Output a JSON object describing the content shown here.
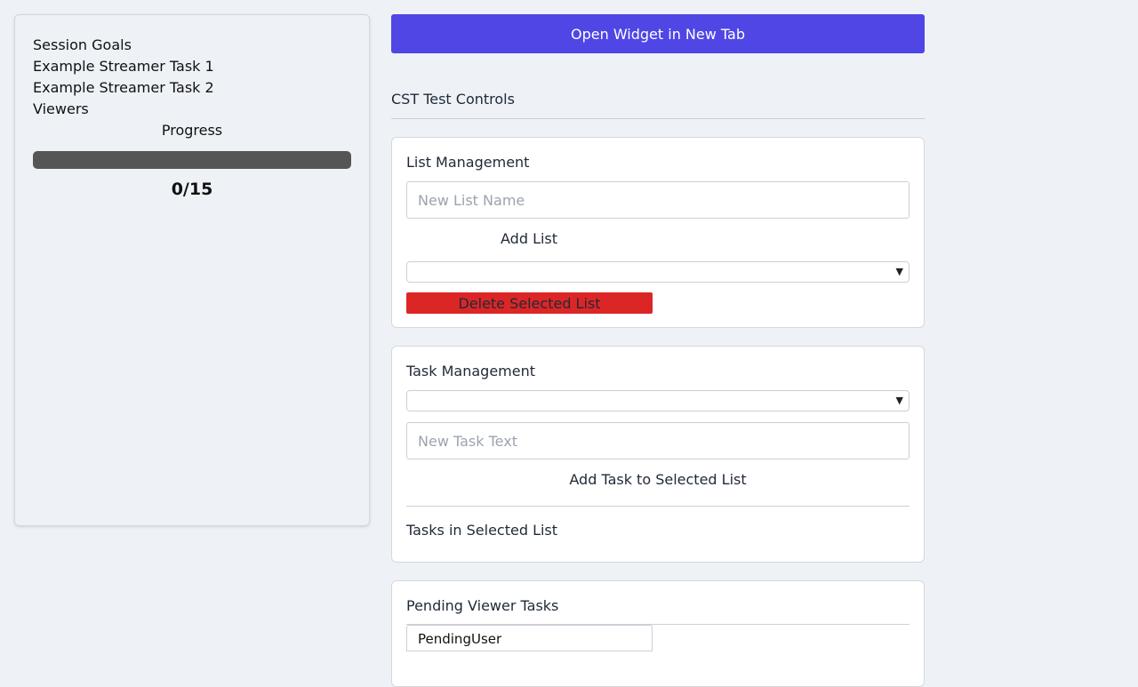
{
  "widget": {
    "title": "Session Goals",
    "tasks": [
      "Example Streamer Task 1",
      "Example Streamer Task 2"
    ],
    "viewers_label": "Viewers",
    "progress_label": "Progress",
    "progress_completed": 0,
    "progress_total": 15,
    "progress_text": "0/15"
  },
  "controls": {
    "open_button": "Open Widget in New Tab",
    "section_title": "CST Test Controls",
    "list_management": {
      "title": "List Management",
      "name_placeholder": "New List Name",
      "add_button": "Add List",
      "selected_list": "",
      "delete_button": "Delete Selected List"
    },
    "task_management": {
      "title": "Task Management",
      "selected_list": "",
      "task_placeholder": "New Task Text",
      "add_button": "Add Task to Selected List",
      "tasks_heading": "Tasks in Selected List"
    },
    "pending": {
      "title": "Pending Viewer Tasks",
      "first_user": "PendingUser"
    }
  },
  "colors": {
    "accent": "#4f46e5",
    "danger": "#dc2626",
    "progress_track": "#555555",
    "background": "#eef2f7"
  },
  "icons": {
    "select_chevron": "chevron-down-icon"
  }
}
